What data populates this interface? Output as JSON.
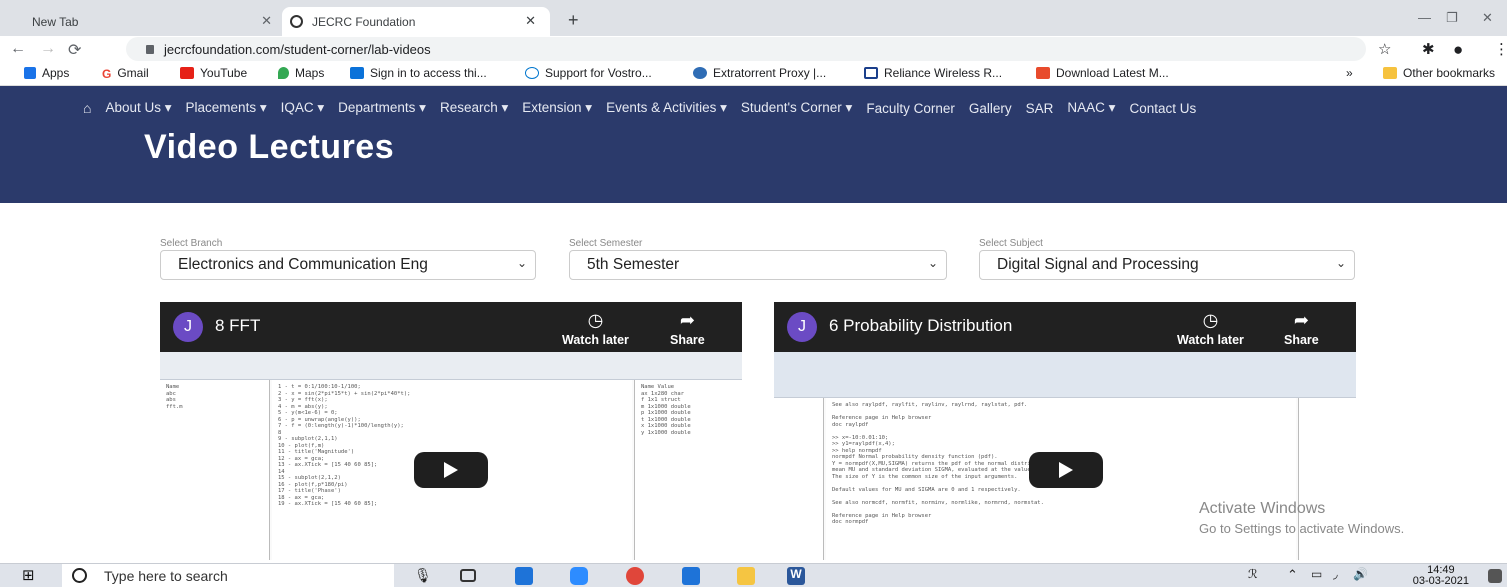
{
  "browser": {
    "tabs": [
      {
        "title": "New Tab"
      },
      {
        "title": "JECRC Foundation"
      }
    ],
    "new_tab_icon": "plus-icon",
    "url": "jecrcfoundation.com/student-corner/lab-videos",
    "bookmarks": [
      {
        "label": "Apps"
      },
      {
        "label": "Gmail"
      },
      {
        "label": "YouTube"
      },
      {
        "label": "Maps"
      },
      {
        "label": "Sign in to access thi..."
      },
      {
        "label": "Support for Vostro..."
      },
      {
        "label": "Extratorrent Proxy |..."
      },
      {
        "label": "Reliance Wireless R..."
      },
      {
        "label": "Download Latest M..."
      }
    ],
    "bookmarks_overflow": "»",
    "other_bookmarks": "Other bookmarks"
  },
  "site_nav": {
    "home_icon": "home-icon",
    "items": [
      "About Us ▾",
      "Placements ▾",
      "IQAC ▾",
      "Departments ▾",
      "Research ▾",
      "Extension ▾",
      "Events & Activities ▾",
      "Student's Corner ▾",
      "Faculty Corner",
      "Gallery",
      "SAR",
      "NAAC ▾",
      "Contact Us"
    ]
  },
  "hero": {
    "title": "Video Lectures"
  },
  "filters": {
    "branch": {
      "label": "Select Branch",
      "value": "Electronics and Communication Eng"
    },
    "semester": {
      "label": "Select Semester",
      "value": "5th Semester"
    },
    "subject": {
      "label": "Select Subject",
      "value": "Digital Signal and Processing"
    }
  },
  "videos": [
    {
      "avatar": "J",
      "title": "8 FFT",
      "watch_later": "Watch later",
      "share": "Share"
    },
    {
      "avatar": "J",
      "title": "6 Probability Distribution",
      "watch_later": "Watch later",
      "share": "Share"
    }
  ],
  "watermark": {
    "line1": "Activate Windows",
    "line2": "Go to Settings to activate Windows."
  },
  "taskbar": {
    "search_placeholder": "Type here to search",
    "time": "14:49",
    "date": "03-03-2021"
  },
  "colors": {
    "nav_bg": "#2b3a6b",
    "avatar": "#6b4bc4",
    "tabstrip": "#dee1e6"
  }
}
